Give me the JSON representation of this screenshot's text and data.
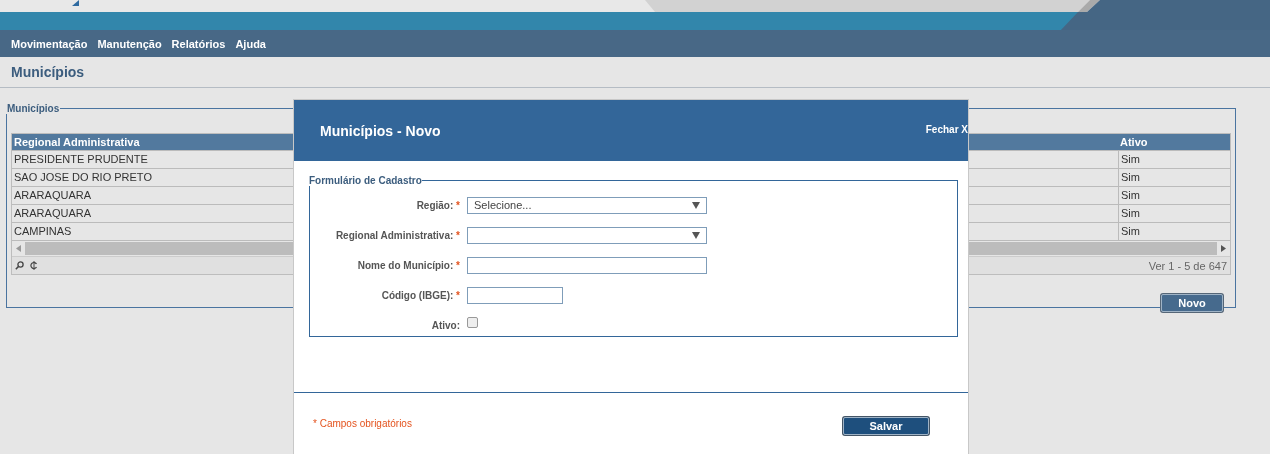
{
  "header": {
    "menu": [
      "Movimentação",
      "Manutenção",
      "Relatórios",
      "Ajuda"
    ]
  },
  "page_title": "Municípios",
  "grid_panel": {
    "legend": "Municípios",
    "columns": [
      "Regional Administrativa",
      "Ativo"
    ],
    "rows": [
      {
        "regional": "PRESIDENTE PRUDENTE",
        "ativo": "Sim"
      },
      {
        "regional": "SAO JOSE DO RIO PRETO",
        "ativo": "Sim"
      },
      {
        "regional": "ARARAQUARA",
        "ativo": "Sim"
      },
      {
        "regional": "ARARAQUARA",
        "ativo": "Sim"
      },
      {
        "regional": "CAMPINAS",
        "ativo": "Sim"
      }
    ],
    "pager_text": "Ver 1 - 5 de 647",
    "new_button": "Novo"
  },
  "modal": {
    "title": "Municípios - Novo",
    "close": "Fechar X",
    "legend": "Formulário de Cadastro",
    "fields": [
      {
        "kind": "select",
        "label": "Região:",
        "required_mark": "*",
        "value": "Selecione..."
      },
      {
        "kind": "select",
        "label": "Regional Administrativa:",
        "required_mark": "*"
      },
      {
        "kind": "text",
        "label": "Nome do Município:",
        "required_mark": "*"
      },
      {
        "kind": "short-text",
        "label": "Código (IBGE):",
        "required_mark": "*"
      },
      {
        "kind": "checkbox",
        "label": "Ativo:",
        "checked": false
      }
    ],
    "required_note": "* Campos obrigatórios",
    "save_button": "Salvar"
  }
}
